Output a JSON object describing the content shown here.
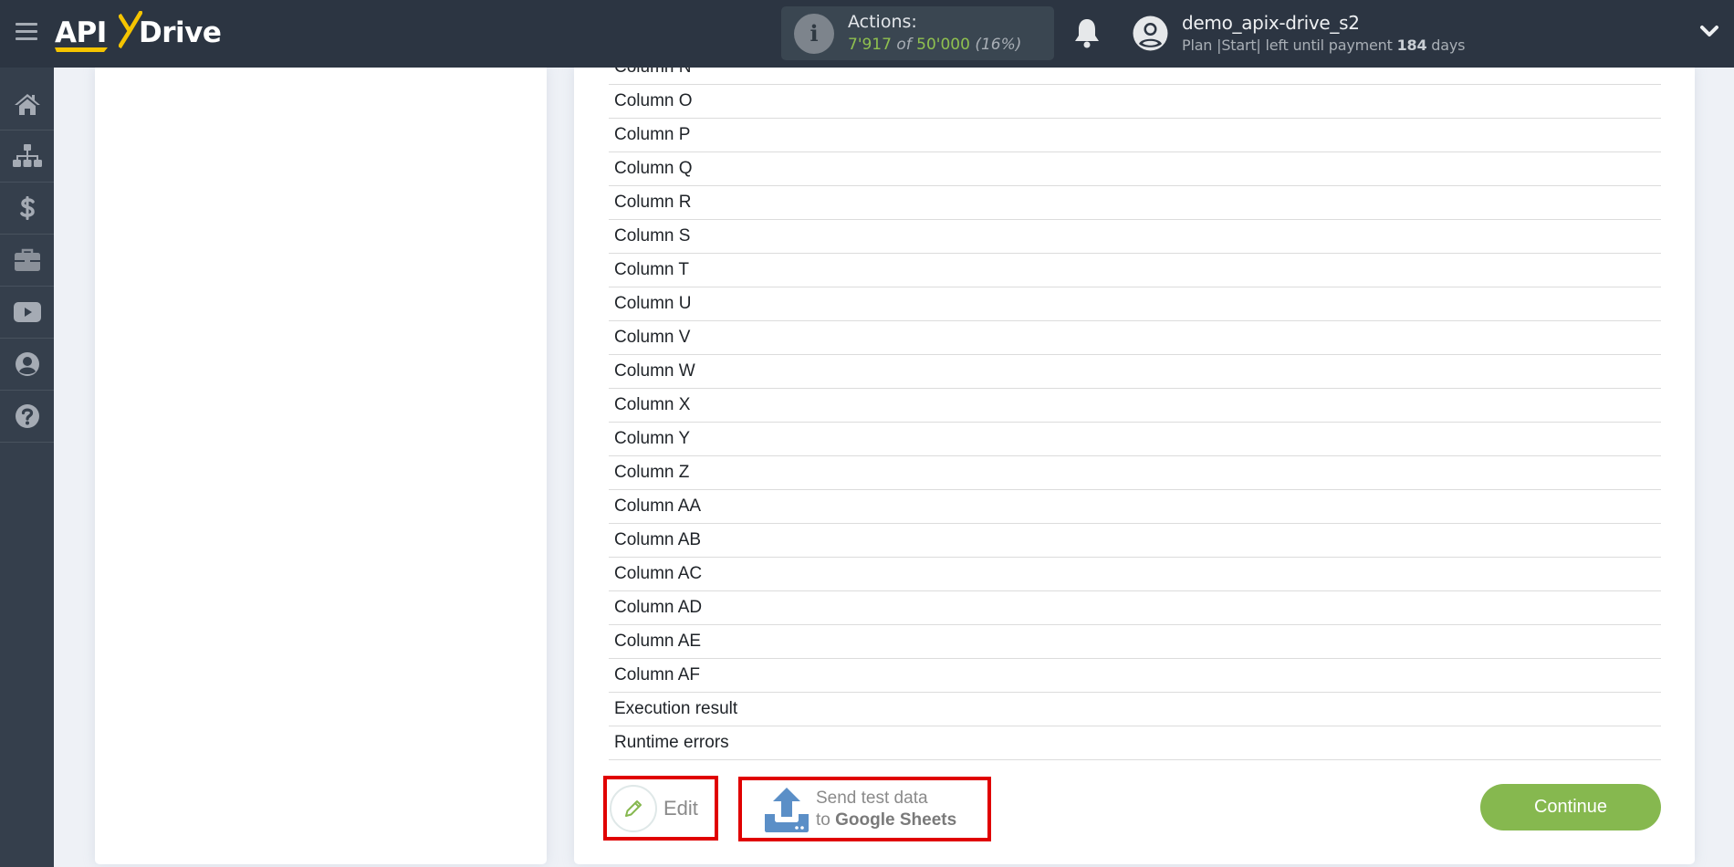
{
  "header": {
    "logo": {
      "api": "API",
      "x": "X",
      "drive": "Drive"
    },
    "actions": {
      "label": "Actions:",
      "used": "7'917",
      "of": "of",
      "total": "50'000",
      "percent": "(16%)"
    },
    "user": {
      "name": "demo_apix-drive_s2",
      "plan_prefix": "Plan |Start| left until payment",
      "days": "184",
      "days_suffix": "days"
    }
  },
  "sidebar": {
    "items": [
      {
        "icon": "home-icon"
      },
      {
        "icon": "sitemap-icon"
      },
      {
        "icon": "dollar-icon"
      },
      {
        "icon": "briefcase-icon"
      },
      {
        "icon": "youtube-icon"
      },
      {
        "icon": "user-icon"
      },
      {
        "icon": "help-icon"
      }
    ]
  },
  "main": {
    "rows": [
      "Column N",
      "Column O",
      "Column P",
      "Column Q",
      "Column R",
      "Column S",
      "Column T",
      "Column U",
      "Column V",
      "Column W",
      "Column X",
      "Column Y",
      "Column Z",
      "Column AA",
      "Column AB",
      "Column AC",
      "Column AD",
      "Column AE",
      "Column AF",
      "Execution result",
      "Runtime errors"
    ],
    "edit_label": "Edit",
    "send": {
      "line1": "Send test data",
      "line2_prefix": "to",
      "line2_bold": "Google Sheets"
    },
    "continue_label": "Continue"
  },
  "colors": {
    "header_bg": "#2c3542",
    "sidebar_bg": "#353f4c",
    "accent_green": "#86b84f",
    "logo_yellow": "#f5c400",
    "highlight_red": "#e00000"
  }
}
